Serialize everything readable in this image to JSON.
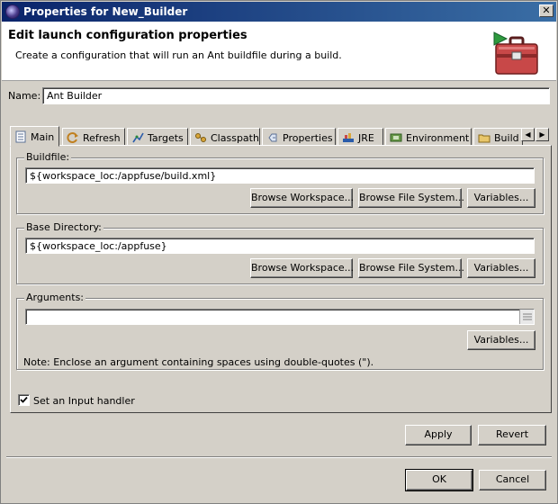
{
  "window": {
    "title": "Properties for New_Builder",
    "close_glyph": "✕"
  },
  "header": {
    "title": "Edit launch configuration properties",
    "description": "Create a configuration that will run an Ant buildfile during a build.",
    "icon": "ant-toolbox-icon"
  },
  "name_field": {
    "label": "Name:",
    "value": "Ant Builder"
  },
  "tabs": [
    {
      "label": "Main",
      "icon": "document-icon",
      "active": true
    },
    {
      "label": "Refresh",
      "icon": "refresh-icon"
    },
    {
      "label": "Targets",
      "icon": "targets-icon"
    },
    {
      "label": "Classpath",
      "icon": "classpath-icon"
    },
    {
      "label": "Properties",
      "icon": "properties-icon"
    },
    {
      "label": "JRE",
      "icon": "jre-icon"
    },
    {
      "label": "Environment",
      "icon": "environment-icon"
    },
    {
      "label": "Build O",
      "icon": "folder-icon"
    }
  ],
  "buildfile": {
    "label": "Buildfile:",
    "value": "${workspace_loc:/appfuse/build.xml}",
    "browse_workspace": "Browse Workspace...",
    "browse_fs": "Browse File System...",
    "variables": "Variables..."
  },
  "base_directory": {
    "label": "Base Directory:",
    "value": "${workspace_loc:/appfuse}",
    "browse_workspace": "Browse Workspace...",
    "browse_fs": "Browse File System...",
    "variables": "Variables..."
  },
  "arguments": {
    "label": "Arguments:",
    "value": "",
    "variables": "Variables...",
    "note": "Note: Enclose an argument containing spaces using double-quotes (\")."
  },
  "input_handler": {
    "label": "Set an Input handler",
    "checked": true
  },
  "actions": {
    "apply": "Apply",
    "revert": "Revert",
    "ok": "OK",
    "cancel": "Cancel"
  }
}
